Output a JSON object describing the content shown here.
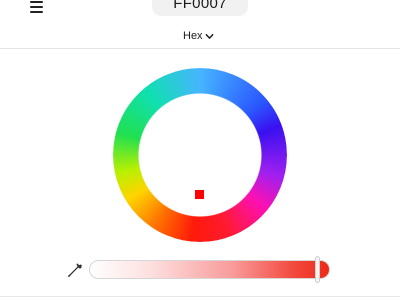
{
  "header": {
    "menu_icon": "hamburger-menu-icon",
    "hex_value": "FF0007"
  },
  "format_selector": {
    "label": "Hex",
    "icon": "chevron-down-icon"
  },
  "color_wheel": {
    "selected_color": "#ff0007"
  },
  "brightness": {
    "eyedropper_icon": "eyedropper-icon",
    "level": 0.94,
    "start_color": "#ffffff",
    "end_color": "#ee2a18"
  }
}
